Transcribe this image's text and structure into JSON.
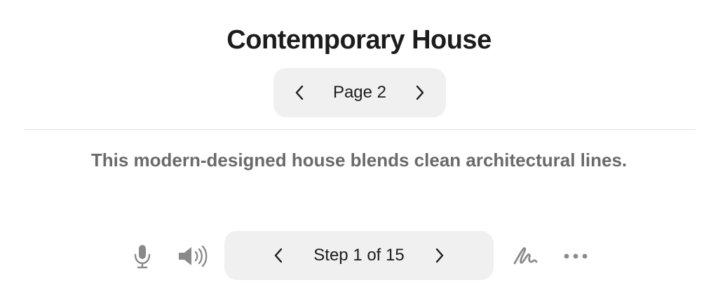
{
  "title": "Contemporary House",
  "page_pager": {
    "label": "Page 2",
    "prev_icon": "chevron-left-icon",
    "next_icon": "chevron-right-icon"
  },
  "description": "This modern-designed house blends clean architectural lines.",
  "toolbar": {
    "mic_icon": "microphone-icon",
    "speaker_icon": "speaker-icon",
    "step_label": "Step 1 of 15",
    "step_prev_icon": "chevron-left-icon",
    "step_next_icon": "chevron-right-icon",
    "draw_icon": "scribble-icon",
    "more_icon": "more-icon"
  },
  "colors": {
    "pill_bg": "#f0f0f0",
    "icon_gray": "#8a8a8a",
    "text_dark": "#1c1c1c",
    "text_gray": "#6a6a6a"
  }
}
